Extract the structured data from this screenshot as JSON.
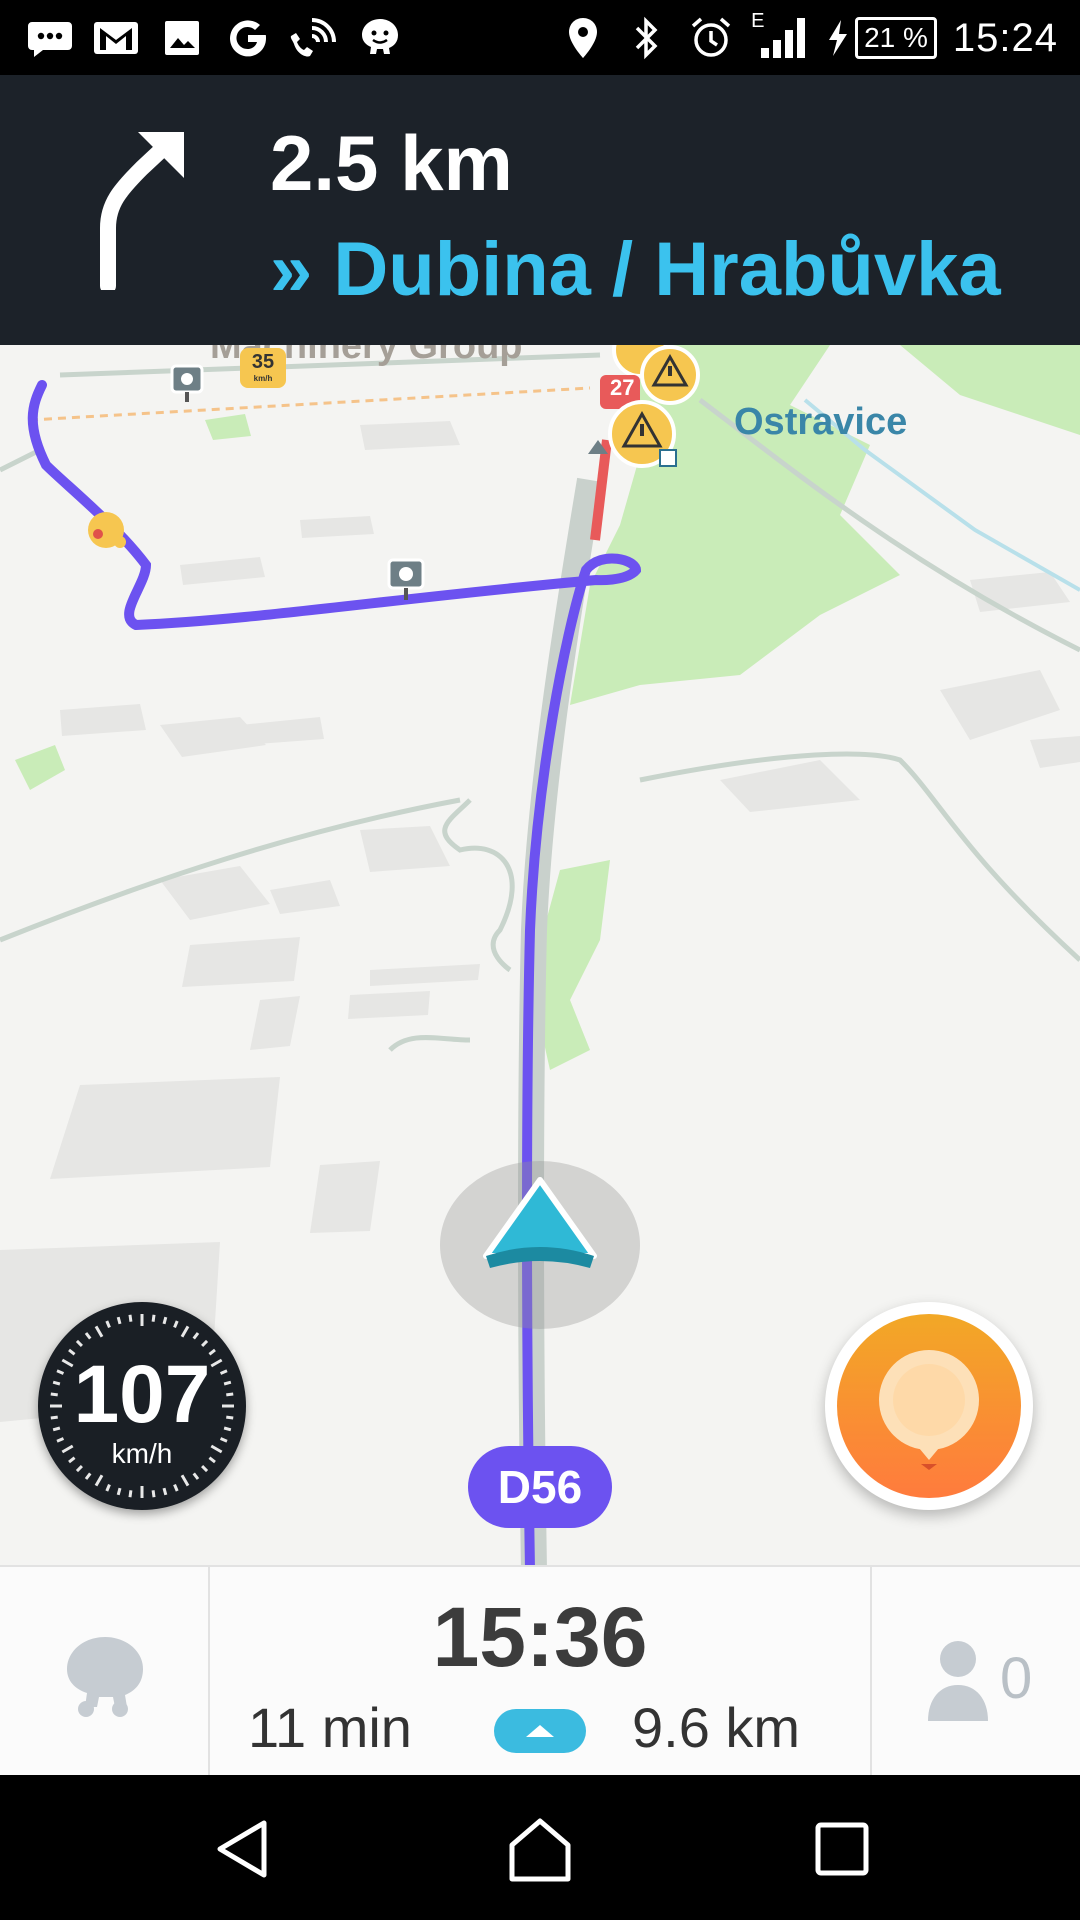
{
  "status_bar": {
    "clock": "15:24",
    "battery": "21 %",
    "network_type": "E",
    "icons": [
      "messages-icon",
      "gmail-icon",
      "gallery-icon",
      "google-icon",
      "wifi-calling-icon",
      "waze-icon",
      "location-icon",
      "bluetooth-icon",
      "alarm-icon",
      "signal-icon",
      "charging-icon",
      "battery-icon"
    ]
  },
  "navigation": {
    "distance": "2.5 km",
    "street": "» Dubina / Hrabůvka",
    "turn_icon": "turn-right-icon"
  },
  "map": {
    "labels": {
      "place": "Ostravice",
      "poi": "Machinery Group"
    },
    "speed_limit_sign": "35",
    "speed_limit_unit": "km/h",
    "traffic_badge": "27",
    "road_badge": "D56",
    "colors": {
      "route": "#6c52f0",
      "traffic": "#e85a5a",
      "position_arrow": "#2fb9d6",
      "park": "#c9ecb8"
    }
  },
  "speedometer": {
    "value": "107",
    "unit": "km/h"
  },
  "trip": {
    "eta": "15:36",
    "duration": "11 min",
    "distance": "9.6 km",
    "riders": "0"
  }
}
